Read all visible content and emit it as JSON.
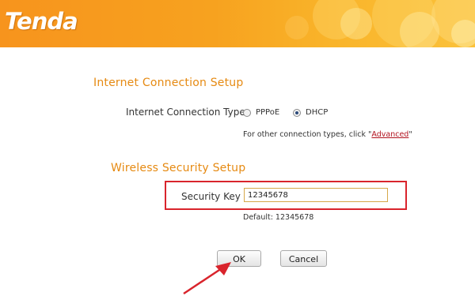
{
  "header": {
    "brand": "Tenda"
  },
  "internet": {
    "title": "Internet Connection Setup",
    "type_label": "Internet Connection Type",
    "options": [
      {
        "label": "PPPoE",
        "selected": false
      },
      {
        "label": "DHCP",
        "selected": true
      }
    ],
    "hint_prefix": "For other connection types, click \"",
    "hint_link": "Advanced",
    "hint_suffix": "\""
  },
  "wireless": {
    "title": "Wireless Security Setup",
    "key_label": "Security Key",
    "key_value": "12345678",
    "default_text": "Default: 12345678"
  },
  "actions": {
    "ok_label": "OK",
    "cancel_label": "Cancel"
  },
  "colors": {
    "header": "#f7941d",
    "section_title": "#e68a12",
    "annotation": "#d9242c",
    "link": "#b1121e"
  }
}
